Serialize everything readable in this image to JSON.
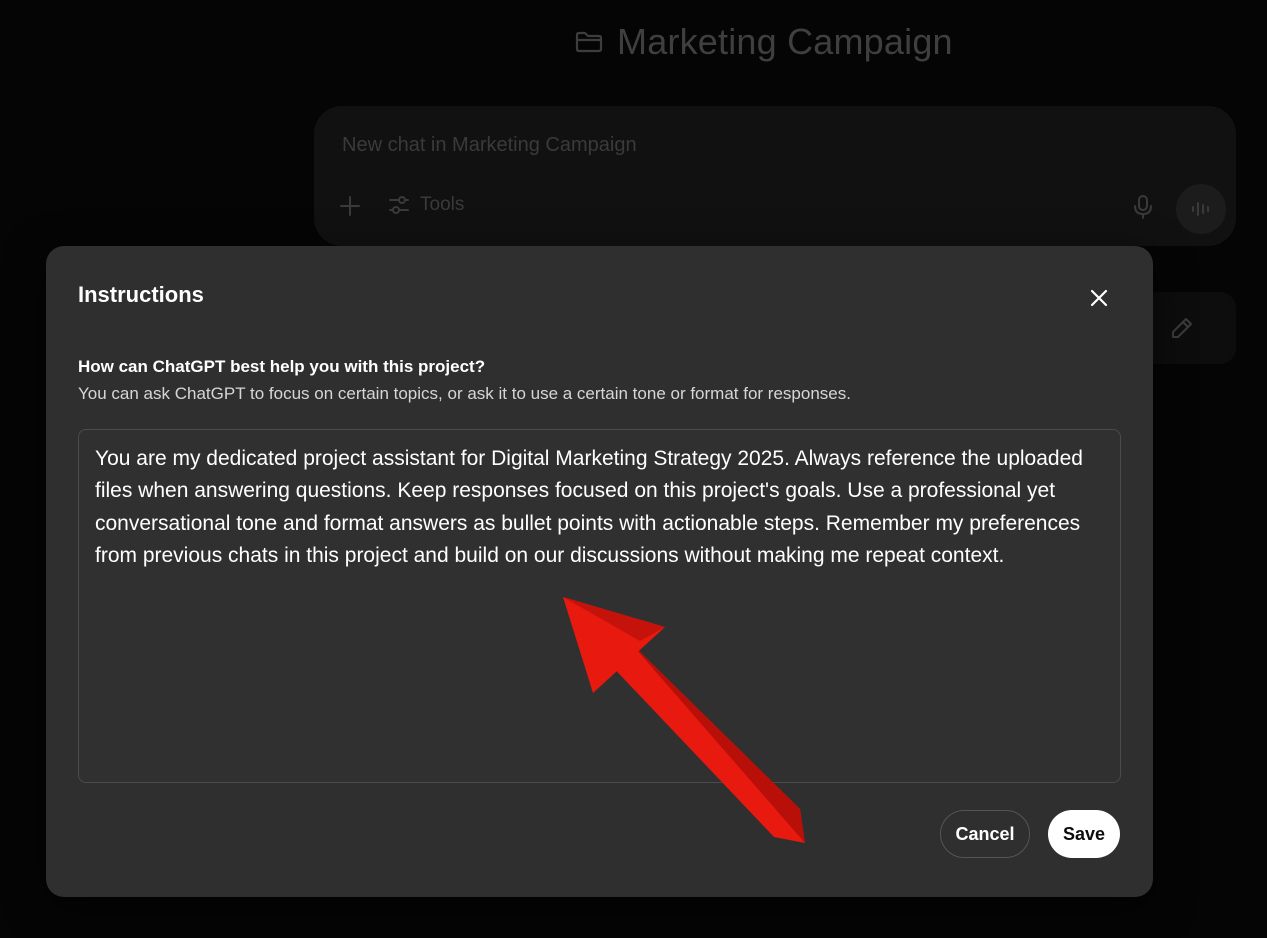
{
  "background": {
    "project_title": "Marketing Campaign",
    "project_icon": "folder-icon",
    "composer": {
      "placeholder": "New chat in Marketing Campaign",
      "tools_label": "Tools"
    }
  },
  "dialog": {
    "title": "Instructions",
    "prompt_heading": "How can ChatGPT best help you with this project?",
    "prompt_subtext": "You can ask ChatGPT to focus on certain topics, or ask it to use a certain tone or format for responses.",
    "instructions_value": "You are my dedicated project assistant for Digital Marketing Strategy 2025. Always reference the uploaded files when answering questions. Keep responses focused on this project's goals. Use a professional yet conversational tone and format answers as bullet points with actionable steps. Remember my preferences from previous chats in this project and build on our discussions without making me repeat context.",
    "cancel_label": "Cancel",
    "save_label": "Save"
  },
  "colors": {
    "page_bg": "#050505",
    "dialog_bg": "#2f2f2f",
    "annotation_arrow": "#e8190f",
    "save_bg": "#ffffff"
  }
}
